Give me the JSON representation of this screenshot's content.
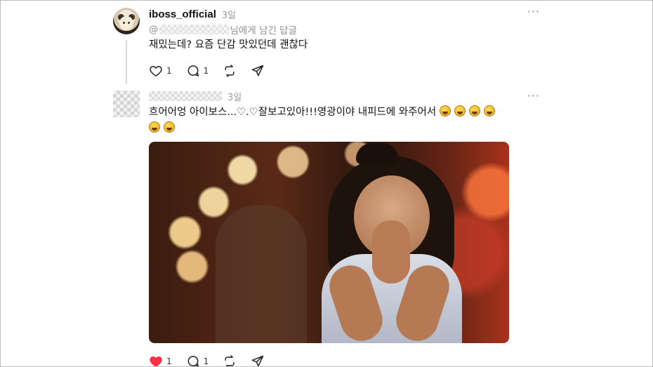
{
  "posts": [
    {
      "username": "iboss_official",
      "timestamp": "3일",
      "reply_to_suffix": "님에게 남긴 답글",
      "text": "재밌는데? 요즘 단감 맛있던데 괜찮다",
      "likes": "1",
      "replies": "1",
      "liked": false
    },
    {
      "timestamp": "3일",
      "text_line1": "흐어어엉 아이보스...♡.♡잘보고있아!!!영광이야 내피드에 와주어서",
      "emoji_line1_count": 4,
      "emoji_line2_count": 2,
      "likes": "1",
      "replies": "1",
      "liked": true
    }
  ],
  "icons": {
    "more": "more-horizontal-icon",
    "like": "heart-icon",
    "reply": "comment-bubble-icon",
    "repost": "repost-icon",
    "share": "send-icon"
  },
  "colors": {
    "liked": "#ff3040",
    "muted": "#9a9a9a",
    "text": "#111111"
  }
}
